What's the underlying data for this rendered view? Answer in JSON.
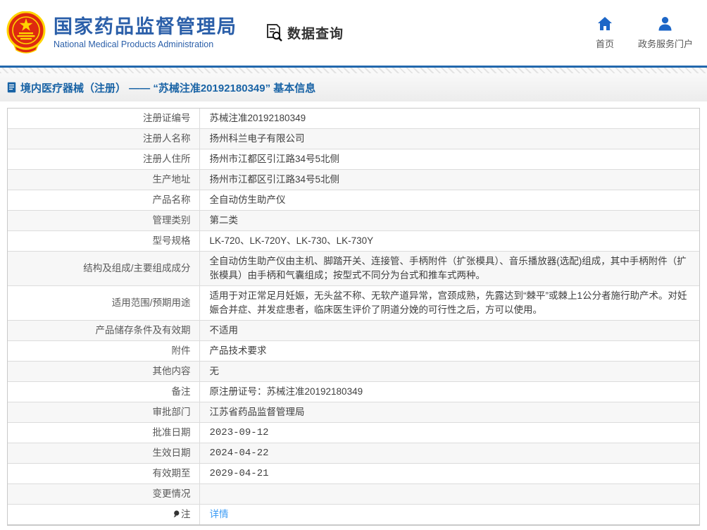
{
  "header": {
    "logo_title_cn": "国家药品监督管理局",
    "logo_subtitle_en": "National Medical Products Administration",
    "data_query_label": "数据查询",
    "nav": [
      {
        "label": "首页"
      },
      {
        "label": "政务服务门户"
      }
    ]
  },
  "breadcrumb": {
    "text": "境内医疗器械（注册） —— “苏械注准20192180349” 基本信息"
  },
  "table": {
    "rows": [
      {
        "label": "注册证编号",
        "value": "苏械注准20192180349"
      },
      {
        "label": "注册人名称",
        "value": "扬州科兰电子有限公司"
      },
      {
        "label": "注册人住所",
        "value": "扬州市江都区引江路34号5北侧"
      },
      {
        "label": "生产地址",
        "value": "扬州市江都区引江路34号5北侧"
      },
      {
        "label": "产品名称",
        "value": "全自动仿生助产仪"
      },
      {
        "label": "管理类别",
        "value": "第二类"
      },
      {
        "label": "型号规格",
        "value": "LK-720、LK-720Y、LK-730、LK-730Y"
      },
      {
        "label": "结构及组成/主要组成成分",
        "value": "全自动仿生助产仪由主机、脚踏开关、连接管、手柄附件（扩张模具）、音乐播放器(选配)组成，其中手柄附件（扩张模具）由手柄和气囊组成；按型式不同分为台式和推车式两种。"
      },
      {
        "label": "适用范围/预期用途",
        "value": "适用于对正常足月妊娠，无头盆不称、无软产道异常，宫颈成熟，先露达到“棘平”或棘上1公分者施行助产术。对妊娠合并症、并发症患者，临床医生评价了阴道分娩的可行性之后，方可以使用。"
      },
      {
        "label": "产品储存条件及有效期",
        "value": "不适用"
      },
      {
        "label": "附件",
        "value": "产品技术要求"
      },
      {
        "label": "其他内容",
        "value": "无"
      },
      {
        "label": "备注",
        "value": "原注册证号：苏械注准20192180349"
      },
      {
        "label": "审批部门",
        "value": "江苏省药品监督管理局"
      },
      {
        "label": "批准日期",
        "value": "2023-09-12"
      },
      {
        "label": "生效日期",
        "value": "2024-04-22"
      },
      {
        "label": "有效期至",
        "value": "2029-04-21"
      },
      {
        "label": "变更情况",
        "value": ""
      },
      {
        "label": "注",
        "value": "详情"
      }
    ]
  },
  "icons": {
    "logo": "national-emblem-icon",
    "query": "document-search-icon",
    "home": "home-icon",
    "portal": "person-icon",
    "breadcrumb": "document-icon",
    "note": "bulb-icon"
  },
  "colors": {
    "brand_blue": "#2b5fa9",
    "nav_icon_blue": "#1c66c7",
    "breadcrumb_blue": "#1a64a6",
    "link_blue": "#3e9df5",
    "emblem_red": "#de2910",
    "emblem_gold": "#ffd400",
    "row_alt_bg": "#f7f7f7",
    "table_border": "#dcdcdc"
  }
}
